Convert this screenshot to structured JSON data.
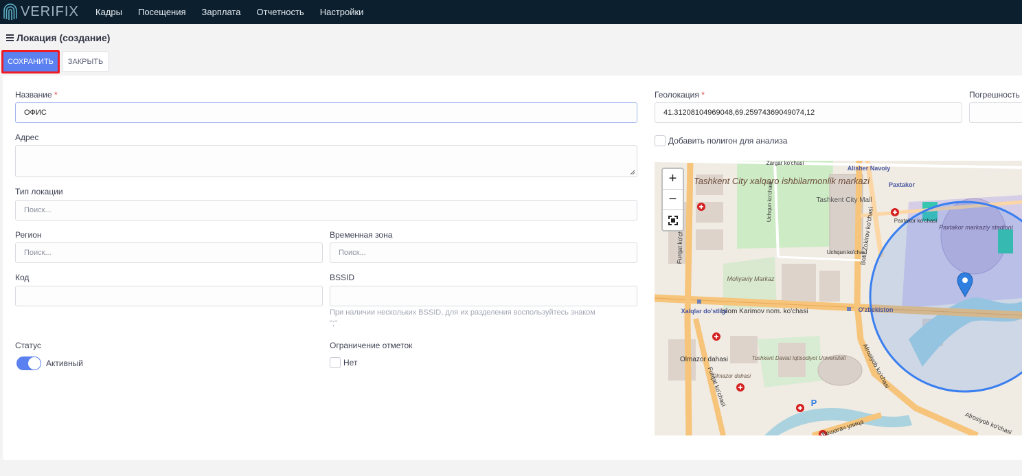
{
  "app": {
    "logo_text": "VERIFIX",
    "nav": [
      "Кадры",
      "Посещения",
      "Зарплата",
      "Отчетность",
      "Настройки"
    ]
  },
  "page": {
    "title": "Локация (создание)",
    "save_label": "СОХРАНИТЬ",
    "close_label": "ЗАКРЫТЬ"
  },
  "form": {
    "name_label": "Название",
    "name_value": "ОФИС",
    "required_mark": "*",
    "address_label": "Адрес",
    "location_type_label": "Тип локации",
    "location_type_placeholder": "Поиск...",
    "region_label": "Регион",
    "region_placeholder": "Поиск...",
    "timezone_label": "Временная зона",
    "timezone_placeholder": "Поиск...",
    "code_label": "Код",
    "bssid_label": "BSSID",
    "bssid_hint_1": "При наличии нескольких BSSID, для их разделения воспользуйтесь знаком",
    "bssid_hint_2": "\";\"",
    "status_label": "Статус",
    "status_value": "Активный",
    "status_active": true,
    "limit_label": "Ограничение отметок",
    "limit_value": "Нет",
    "geo_label": "Геолокация",
    "geo_value": "41.31208104969048,69.25974369049074,12",
    "accuracy_label": "Погрешность",
    "polygon_label": "Добавить полигон для анализа"
  },
  "map": {
    "zoom_in": "+",
    "zoom_out": "−",
    "labels": {
      "park": "Tashkent City xalqaro ishbilarmonlik markazi",
      "mall": "Tashkent City Mall",
      "stadium": "Paxtakor markaziy stadioni",
      "alisher": "Alisher Navoiy",
      "paxtakor": "Paxtakor",
      "paxtakor_st": "Paxtakor ko'chasi",
      "islom": "Islom Karimov nom. ko'chasi",
      "uzbekiston": "O'zbekiston",
      "xalqlar": "Xalqlar do'stligi",
      "olmazor": "Olmazor dahasi",
      "olmazor2": "Olmazor dahasi",
      "moliyaviy": "Moliyaviy Markaz",
      "furqat": "Furqat ko'chasi",
      "furqat2": "Furqat ko'chasi",
      "botir": "Botir Zokirov ko'chasi",
      "afrosiyob": "Afrosiyob ko'chasi",
      "afrosiyob2": "Afrosiyob ko'chasi",
      "uchqun": "Uchqun ko'chasi",
      "uchqun2": "Uchqun ko'chasi",
      "tdiu": "Toshkent Davlat Iqtisodiyot Universiteti",
      "beshagach": "Бешагач улица",
      "zargar": "Zargar ko'chasi",
      "parking": "P"
    },
    "colors": {
      "circle": "#3a7ff0",
      "marker": "#2f7fe0",
      "road": "#f6c47a",
      "park": "#cdebc5",
      "water": "#aad3df"
    }
  }
}
